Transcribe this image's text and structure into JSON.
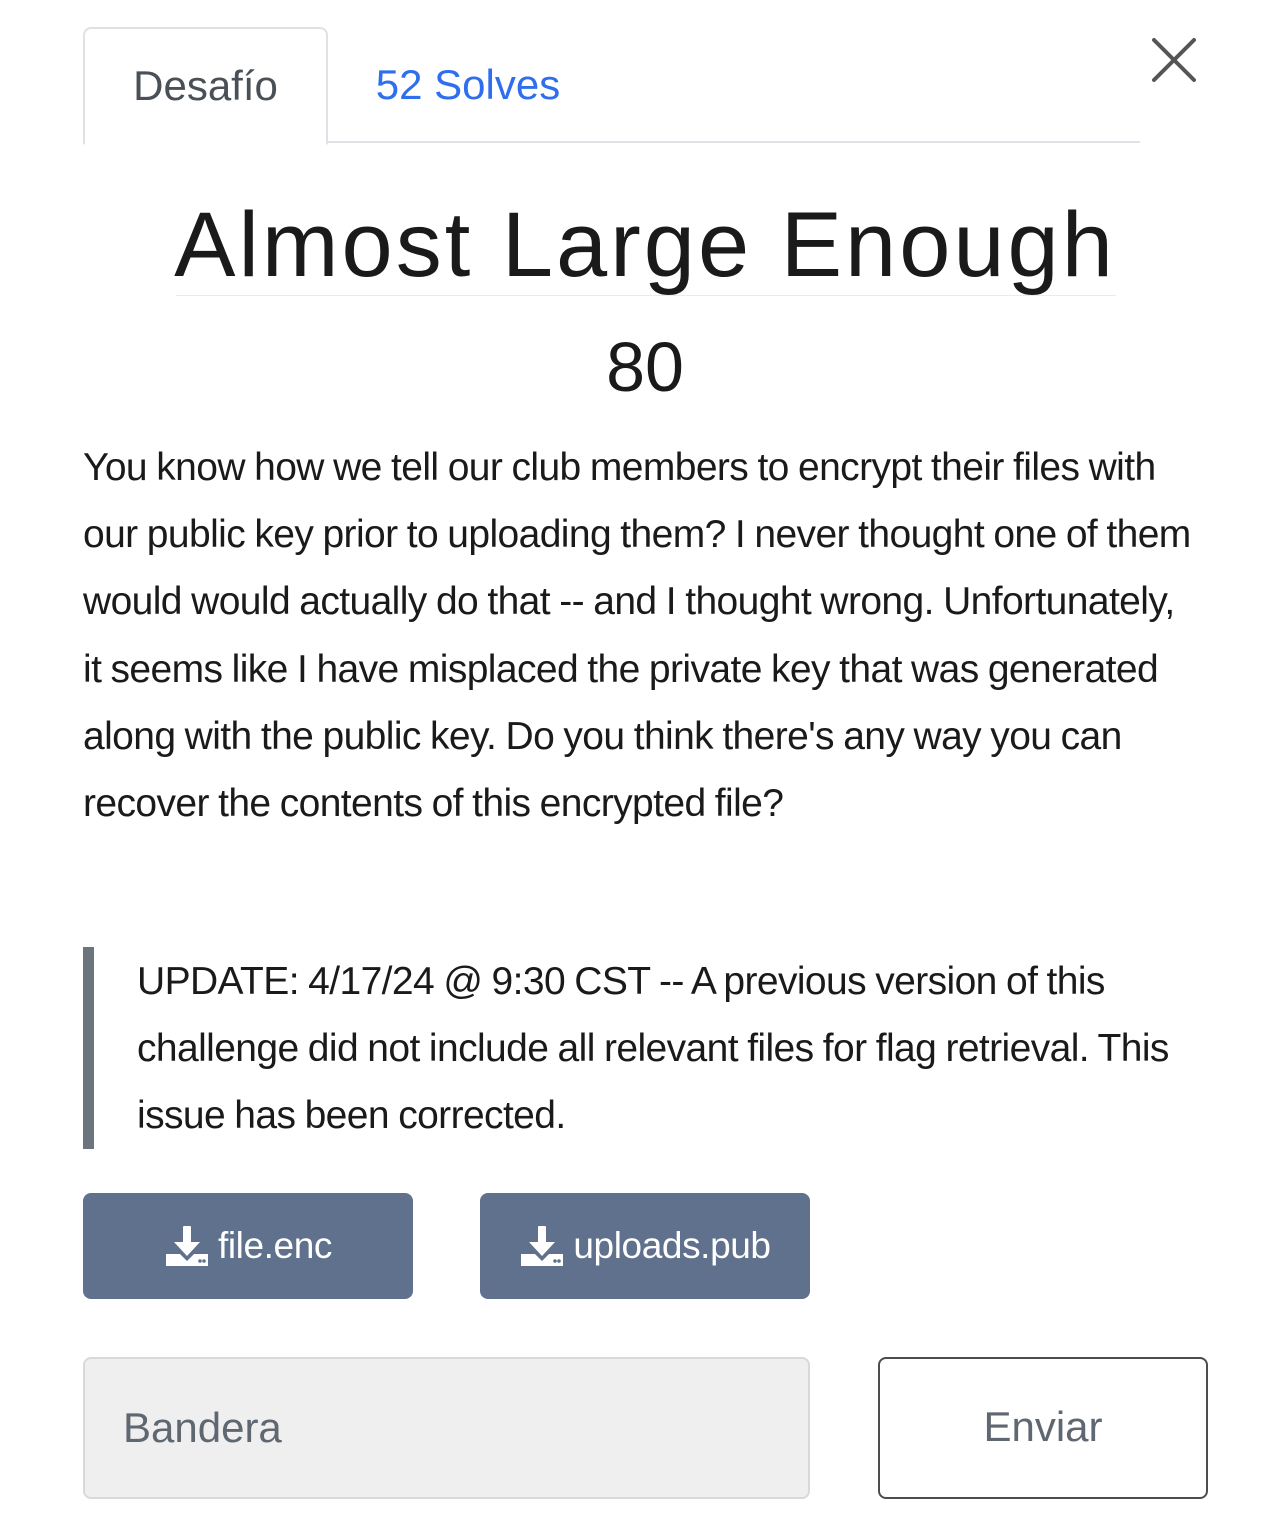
{
  "tabs": {
    "challenge_label": "Desafío",
    "solves_label": "52 Solves"
  },
  "challenge": {
    "title": "Almost Large Enough",
    "points": "80",
    "description": "You know how we tell our club members to encrypt their files with our public key prior to uploading them? I never thought one of them would would actually do that -- and I thought wrong. Unfortunately, it seems like I have misplaced the private key that was generated along with the public key. Do you think there's any way you can recover the contents of this encrypted file?",
    "update": "UPDATE: 4/17/24 @ 9:30 CST -- A previous version of this challenge did not include all relevant files for flag retrieval. This issue has been corrected."
  },
  "files": [
    {
      "name": "file.enc",
      "icon": "download-icon"
    },
    {
      "name": "uploads.pub",
      "icon": "download-icon"
    }
  ],
  "submission": {
    "flag_placeholder": "Bandera",
    "submit_label": "Enviar"
  },
  "colors": {
    "tab_link": "#2f6fed",
    "download_button": "#5f718c",
    "blockquote_border": "#6c757d",
    "input_background": "#efefef"
  }
}
